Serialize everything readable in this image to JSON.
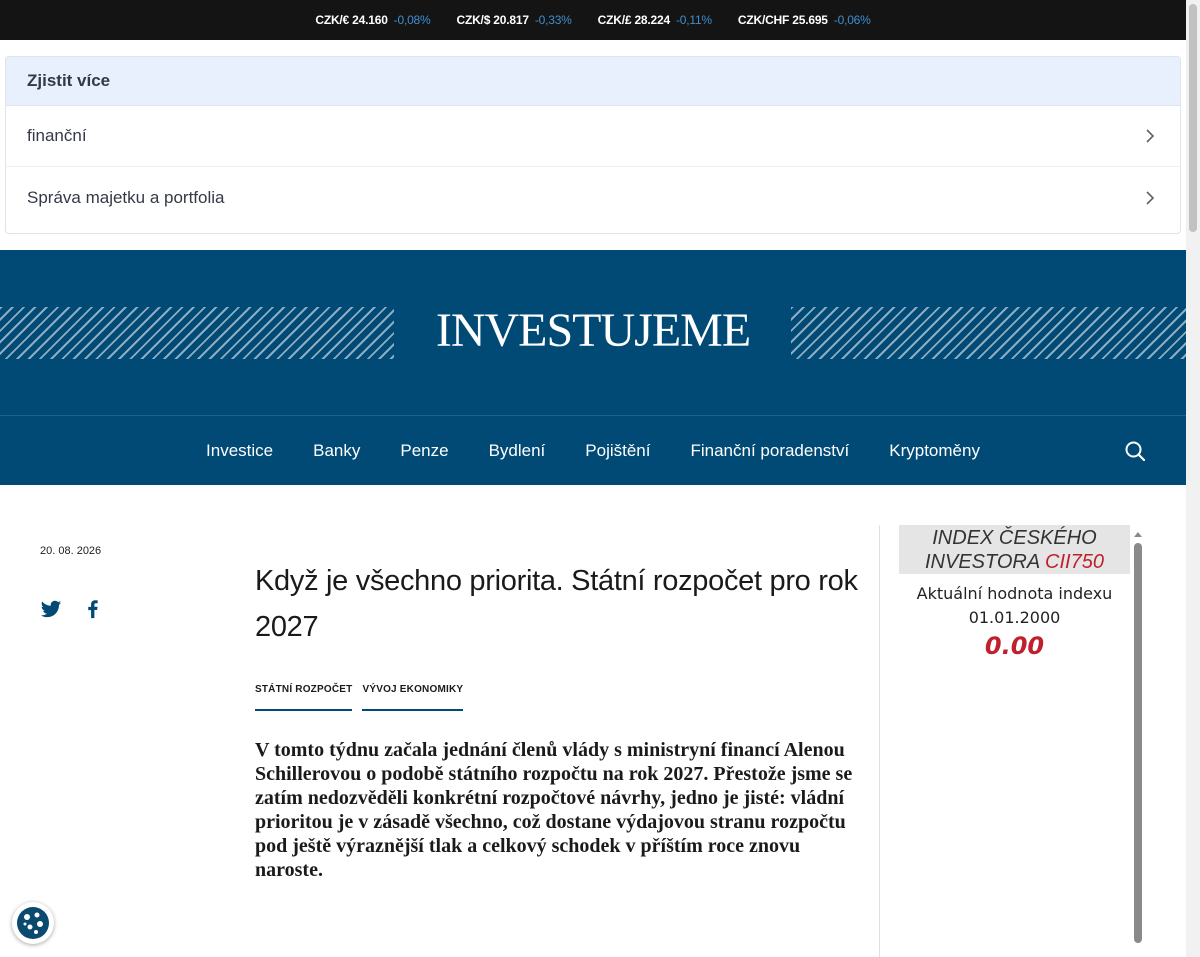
{
  "ticker": [
    {
      "pair": "CZK/€ 24.160",
      "change": "-0,08%"
    },
    {
      "pair": "CZK/$ 20.817",
      "change": "-0,33%"
    },
    {
      "pair": "CZK/£ 28.224",
      "change": "-0,11%"
    },
    {
      "pair": "CZK/CHF 25.695",
      "change": "-0,06%"
    }
  ],
  "learn_more": {
    "title": "Zjistit více",
    "items": [
      "finanční",
      "Správa majetku a portfolia"
    ]
  },
  "site": {
    "logo": "INVESTUJEME"
  },
  "nav": {
    "items": [
      "Investice",
      "Banky",
      "Penze",
      "Bydlení",
      "Pojištění",
      "Finanční poradenství",
      "Kryptoměny"
    ]
  },
  "article": {
    "date": "20. 08. 2026",
    "title": "Když je všechno priorita. Státní rozpočet pro rok 2027",
    "tags": [
      "STÁTNÍ ROZPOČET",
      "VÝVOJ EKONOMIKY"
    ],
    "lead": "V tomto týdnu začala jednání členů vlády s ministryní financí Alenou Schillerovou o podobě státního rozpočtu na rok 2027. Přestože jsme se zatím nedozvěděli konkrétní rozpočtové návrhy, jedno je jisté: vládní prioritou je v zásadě všechno, což dostane výdajovou stranu rozpočtu pod ještě výraznější tlak a celkový schodek v příštím roce znovu naroste."
  },
  "index_widget": {
    "title_main": "INDEX ČESKÉHO INVESTORA",
    "title_code": "CII750",
    "label": "Aktuální hodnota indexu",
    "date": "01.01.2000",
    "value": "0.00"
  },
  "colors": {
    "brand": "#004a75",
    "ticker_bg": "#141414",
    "change_blue": "#3e8fd0",
    "index_red": "#c0202e"
  },
  "icons": [
    "twitter-icon",
    "facebook-icon",
    "search-icon",
    "chevron-right-icon",
    "cookie-icon"
  ]
}
